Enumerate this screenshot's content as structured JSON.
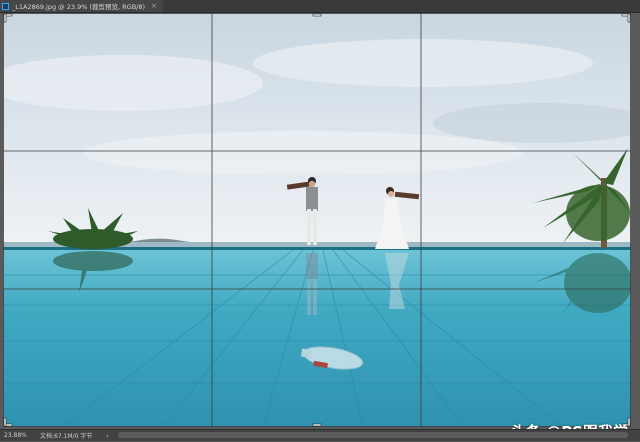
{
  "window": {
    "tab_title": "_L1A2869.jpg @ 23.9% (裁剪预览, RGB/8)",
    "close_glyph": "×"
  },
  "status_bar": {
    "zoom": "23.88%",
    "doc_info": "文档:67.1M/0 字节",
    "arrow_glyph": "›"
  },
  "canvas": {
    "overlay": "rule-of-thirds crop grid",
    "colors": {
      "sky": "#d9e3ea",
      "pool": "#3fa7c0",
      "grid": "#3b3b3b"
    }
  },
  "watermark": {
    "text": "头条 @PS跟我学"
  },
  "icons": [
    "ps-document-icon",
    "close-icon",
    "chevron-right-icon"
  ]
}
